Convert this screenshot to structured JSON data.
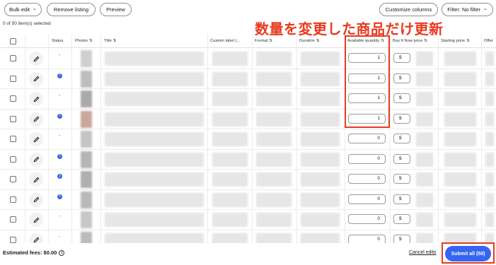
{
  "toolbar": {
    "bulk_edit": "Bulk edit",
    "remove_listing": "Remove listing",
    "preview": "Preview",
    "customize_columns": "Customize columns",
    "filter": "Filter: No filter",
    "selected_count": "0 of 50 item(s) selected"
  },
  "columns": {
    "status": "Status",
    "photos": "Photos",
    "title": "Title",
    "custom_label": "Custom label (...",
    "format": "Format",
    "duration": "Duration",
    "available_quantity": "Available quantity",
    "buy_it_now_price": "Buy It Now price",
    "starting_price": "Starting price",
    "offer": "Offer"
  },
  "sort_icon": "⇅",
  "rows": [
    {
      "status": "-",
      "quantity": "1",
      "price_prefix": "$"
    },
    {
      "status": "info",
      "quantity": "1",
      "price_prefix": "$"
    },
    {
      "status": "-",
      "quantity": "1",
      "price_prefix": "$"
    },
    {
      "status": "info",
      "quantity": "1",
      "price_prefix": "$"
    },
    {
      "status": "-",
      "quantity": "0",
      "price_prefix": "$"
    },
    {
      "status": "info",
      "quantity": "0",
      "price_prefix": "$"
    },
    {
      "status": "info",
      "quantity": "0",
      "price_prefix": "$"
    },
    {
      "status": "info",
      "quantity": "0",
      "price_prefix": "$"
    },
    {
      "status": "-",
      "quantity": "0",
      "price_prefix": "$"
    },
    {
      "status": "-",
      "quantity": "0",
      "price_prefix": "$"
    }
  ],
  "annotation": {
    "text": "数量を変更した商品だけ更新",
    "color": "#e8391f"
  },
  "footer": {
    "estimated_fees": "Estimated fees: $0.00",
    "cancel_edits": "Cancel edits",
    "submit_all": "Submit all (50)"
  },
  "colors": {
    "primary": "#3665f3",
    "annotation_red": "#e8391f"
  }
}
